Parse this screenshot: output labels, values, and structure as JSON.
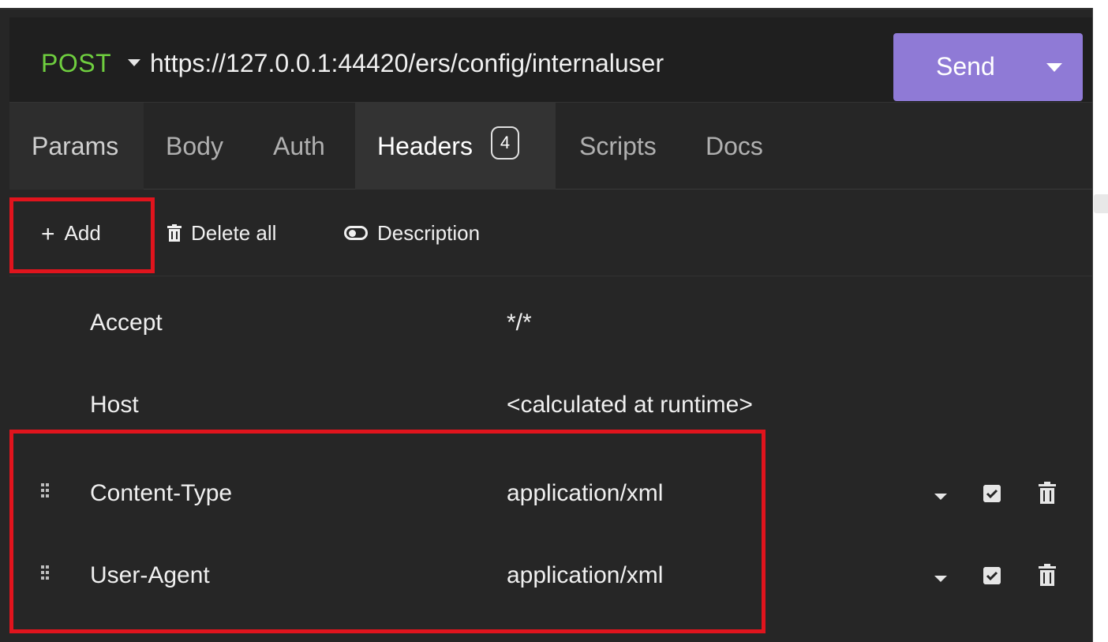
{
  "request": {
    "method": "POST",
    "url": "https://127.0.0.1:44420/ers/config/internaluser",
    "send_label": "Send"
  },
  "tabs": [
    {
      "label": "Params"
    },
    {
      "label": "Body"
    },
    {
      "label": "Auth"
    },
    {
      "label": "Headers",
      "badge": "4",
      "active": true
    },
    {
      "label": "Scripts"
    },
    {
      "label": "Docs"
    }
  ],
  "toolbar": {
    "add_label": "Add",
    "delete_all_label": "Delete all",
    "description_label": "Description"
  },
  "headers": [
    {
      "name": "Accept",
      "value": "*/*",
      "editable": false
    },
    {
      "name": "Host",
      "value": "<calculated at runtime>",
      "editable": false
    },
    {
      "name": "Content-Type",
      "value": "application/xml",
      "editable": true,
      "enabled": true
    },
    {
      "name": "User-Agent",
      "value": "application/xml",
      "editable": true,
      "enabled": true
    }
  ],
  "colors": {
    "method_post": "#6fcf3f",
    "send_button": "#8f7ad6",
    "highlight": "#e0141d",
    "background": "#262626"
  },
  "icons": {
    "add": "plus-icon",
    "delete_all": "trash-icon",
    "description": "toggle-icon",
    "row_grip": "drag-handle-icon",
    "row_menu": "chevron-down-icon",
    "row_enabled": "checkbox-icon",
    "row_delete": "trash-icon"
  }
}
